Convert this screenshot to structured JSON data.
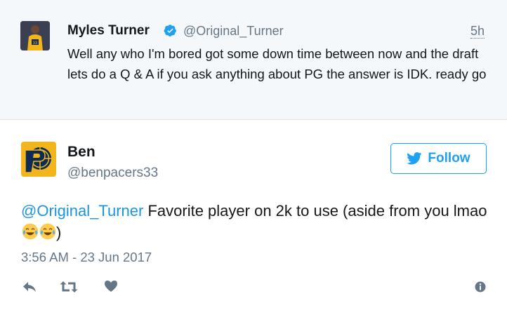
{
  "parent_tweet": {
    "author_name": "Myles Turner",
    "handle": "@Original_Turner",
    "time": "5h",
    "text": "Well any who I'm bored got some down time between now and the draft lets do a Q & A if you ask anything about PG the answer is IDK. ready go",
    "verified_icon": "verified-badge-icon"
  },
  "tweet": {
    "author_name": "Ben",
    "handle": "@benpacers33",
    "mention": "@Original_Turner",
    "text": " Favorite player on 2k to use (aside from you lmao",
    "text_end": ")",
    "emoji": [
      "tears-of-joy-emoji",
      "tears-of-joy-emoji"
    ],
    "timestamp": "3:56 AM - 23 Jun 2017"
  },
  "follow_button": {
    "label": "Follow",
    "icon": "twitter-bird-icon",
    "color": "#1da1f2"
  },
  "actions": {
    "reply_icon": "reply-icon",
    "retweet_icon": "retweet-icon",
    "like_icon": "heart-icon",
    "info_icon": "info-icon"
  },
  "colors": {
    "link": "#1b95e0",
    "secondary_text": "#657786",
    "parent_background": "#f5f8fa"
  }
}
